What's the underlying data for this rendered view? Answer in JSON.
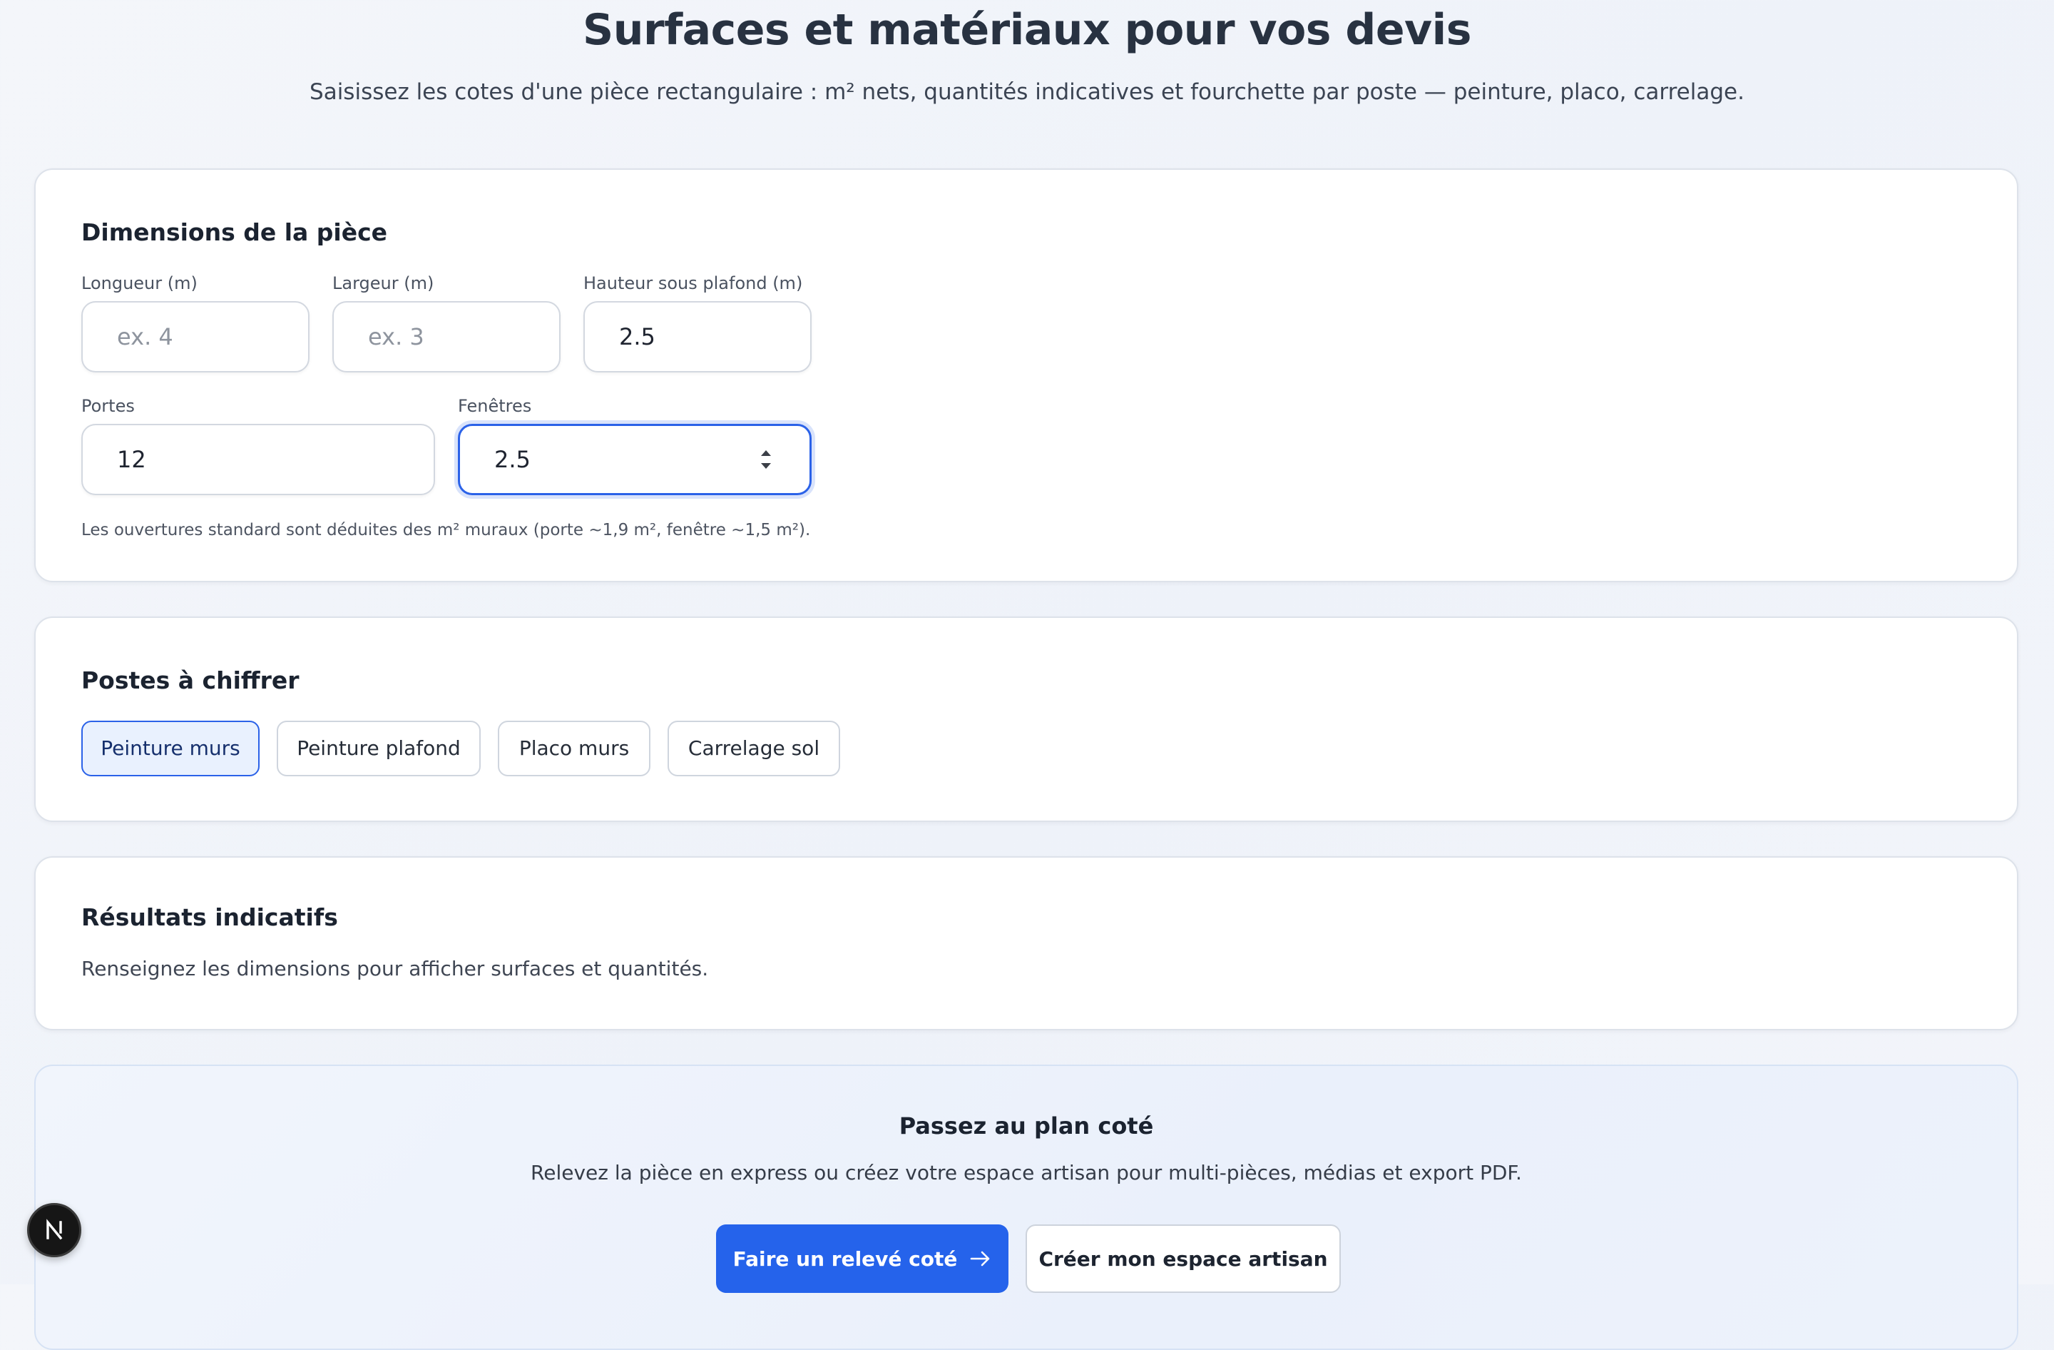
{
  "header": {
    "title": "Surfaces et matériaux pour vos devis",
    "subtitle": "Saisissez les cotes d'une pièce rectangulaire : m² nets, quantités indicatives et fourchette par poste — peinture, placo, carrelage."
  },
  "dimensions": {
    "title": "Dimensions de la pièce",
    "length": {
      "label": "Longueur (m)",
      "placeholder": "ex. 4",
      "value": ""
    },
    "width": {
      "label": "Largeur (m)",
      "placeholder": "ex. 3",
      "value": ""
    },
    "height": {
      "label": "Hauteur sous plafond (m)",
      "value": "2.5"
    },
    "doors": {
      "label": "Portes",
      "value": "12"
    },
    "windows": {
      "label": "Fenêtres",
      "value": "2.5"
    },
    "hint": "Les ouvertures standard sont déduites des m² muraux (porte ~1,9 m², fenêtre ~1,5 m²)."
  },
  "postes": {
    "title": "Postes à chiffrer",
    "items": [
      {
        "label": "Peinture murs",
        "active": true
      },
      {
        "label": "Peinture plafond",
        "active": false
      },
      {
        "label": "Placo murs",
        "active": false
      },
      {
        "label": "Carrelage sol",
        "active": false
      }
    ]
  },
  "results": {
    "title": "Résultats indicatifs",
    "empty_text": "Renseignez les dimensions pour afficher surfaces et quantités."
  },
  "cta": {
    "title": "Passez au plan coté",
    "text": "Relevez la pièce en express ou créez votre espace artisan pour multi-pièces, médias et export PDF.",
    "primary_label": "Faire un relevé coté",
    "secondary_label": "Créer mon espace artisan"
  },
  "badge": {
    "icon": "next-logo-icon"
  },
  "colors": {
    "accent": "#2563eb",
    "chip_active_bg": "#e9f1fe",
    "chip_active_text": "#16306d",
    "card_border": "#dde2ea"
  }
}
